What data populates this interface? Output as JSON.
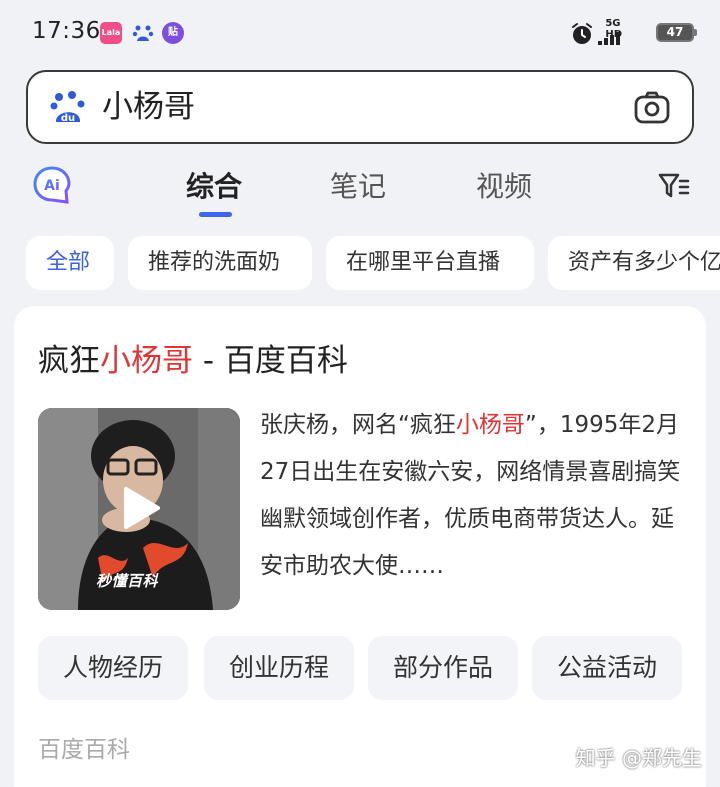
{
  "status_bar": {
    "time": "17:36",
    "notif_1": "Lala",
    "notif_3": "贴",
    "network": "5G HD",
    "battery": "47"
  },
  "search": {
    "query": "小杨哥"
  },
  "tabs": [
    {
      "label": "综合",
      "active": true
    },
    {
      "label": "笔记",
      "active": false
    },
    {
      "label": "视频",
      "active": false
    }
  ],
  "chips": [
    {
      "label": "全部",
      "active": true
    },
    {
      "label": "推荐的洗面奶"
    },
    {
      "label": "在哪里平台直播"
    },
    {
      "label": "资产有多少个亿"
    }
  ],
  "result": {
    "title_prefix": "疯狂",
    "title_highlight": "小杨哥",
    "title_suffix": " - 百度百科",
    "thumbnail_label": "秒懂百科",
    "desc_before": "张庆杨，网名“疯狂",
    "desc_highlight": "小杨哥",
    "desc_after": "”，1995年2月27日出生在安徽六安，网络情景喜剧搞笑幽默领域创作者，优质电商带货达人。延安市助农大使……",
    "buttons": [
      "人物经历",
      "创业历程",
      "部分作品",
      "公益活动"
    ],
    "source": "百度百科"
  },
  "watermark": "知乎 @郑先生",
  "colors": {
    "accent": "#3c62e6",
    "highlight": "#e03535",
    "background": "#f1f2f6"
  }
}
